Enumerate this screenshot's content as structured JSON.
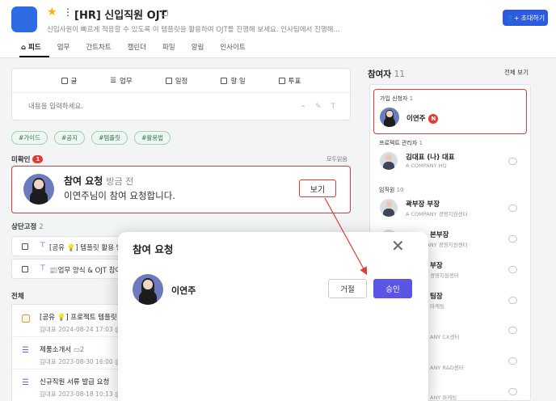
{
  "header": {
    "title": "[HR] 신입직원 OJT",
    "description": "신입사원이 빠르게 적응할 수 있도록 이 템플릿을 활용하여 OJT를 진행해 보세요. 인사팀에서 진행해...",
    "invite_label": "초대하기",
    "tabs": [
      "피드",
      "업무",
      "간트차트",
      "캘린더",
      "파일",
      "알림",
      "인사이트"
    ]
  },
  "composer": {
    "tools": [
      "글",
      "업무",
      "일정",
      "할 일",
      "투표"
    ],
    "placeholder": "내용을 입력하세요."
  },
  "hashtags": [
    "#가이드",
    "#공지",
    "#템플릿",
    "#활용법"
  ],
  "unread": {
    "label": "미확인",
    "count": "1",
    "mark_read": "모두읽음"
  },
  "notification": {
    "title": "참여 요청",
    "time": "방금 전",
    "body": "이연주님이 참여 요청합니다.",
    "view_label": "보기"
  },
  "pinned": {
    "label": "상단고정",
    "count": "2",
    "items": [
      "[공유 💡] 템플릿 활용 방",
      "📰업무 양식 & OJT 참여"
    ]
  },
  "feed": {
    "label": "전체",
    "items": [
      {
        "title": "[공유 💡] 프로젝트 템플릿",
        "meta": "김대표   2024-08-24 17:03 @"
      },
      {
        "title": "제품소개서",
        "comments": "2",
        "meta": "김대표   2023-08-30 16:00 @"
      },
      {
        "title": "신규직원 서류 발급 요청",
        "meta": "김대표   2023-08-18 10:13 @"
      }
    ]
  },
  "participants": {
    "label": "참여자",
    "count": "11",
    "view_all": "전체 보기",
    "applicants": {
      "label": "가입 신청자",
      "count": "1",
      "name": "이연주",
      "badge": "N"
    },
    "managers": {
      "label": "프로젝트 관리자",
      "count": "1",
      "name": "김대표 (나) 대표",
      "sub": "A COMPANY HQ"
    },
    "staff": {
      "label": "임직원",
      "count": "10",
      "members": [
        {
          "name": "곽부장 부장",
          "sub": "A COMPANY 경영지원센터"
        },
        {
          "name": "본부장",
          "sub": "A COMPANY 경영지원센터"
        },
        {
          "name": "부장",
          "sub": "경영지원센터"
        },
        {
          "name": "팀장",
          "sub": "마케팅"
        },
        {
          "name": "",
          "sub": "ANY CX센터"
        },
        {
          "name": "",
          "sub": "ANY R&D센터"
        },
        {
          "name": "",
          "sub": "ANY 마케팅"
        }
      ]
    }
  },
  "modal": {
    "title": "참여 요청",
    "name": "이연주",
    "reject_label": "거절",
    "approve_label": "승인"
  },
  "colors": {
    "accent": "#2d5be0",
    "approve": "#5b55e6",
    "highlight": "#e03b3b",
    "logo": "#2d6be4"
  }
}
